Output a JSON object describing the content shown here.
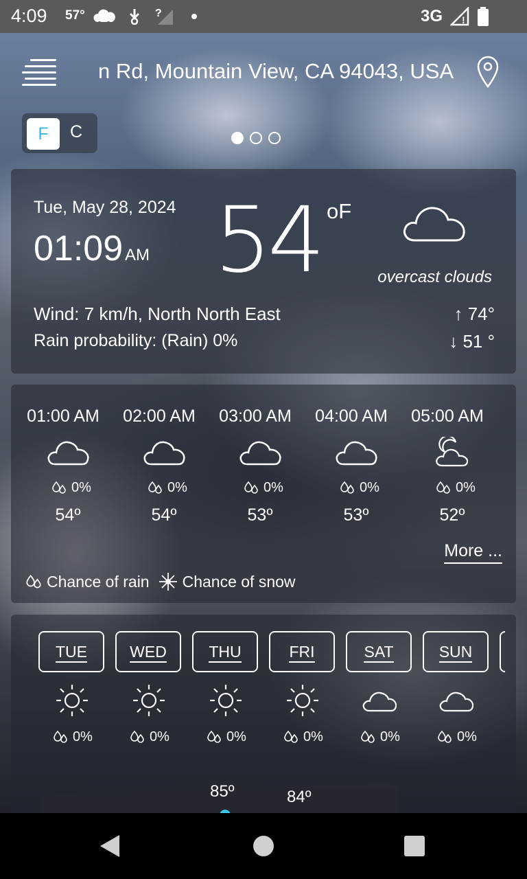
{
  "status_bar": {
    "time": "4:09",
    "temperature": "57°",
    "network": "3G",
    "icons": [
      "cloud-icon",
      "download-icon",
      "signal-unknown-icon",
      "notification-dot",
      "signal-icon",
      "battery-icon"
    ]
  },
  "header": {
    "location": "n Rd, Mountain View, CA 94043, USA",
    "menu_icon": "hamburger-menu-icon",
    "location_icon": "map-pin-icon"
  },
  "units": {
    "f": "F",
    "c": "C",
    "selected": "F"
  },
  "pager": {
    "pages": 3,
    "active": 1
  },
  "current": {
    "date": "Tue, May 28, 2024",
    "time": "01:09",
    "ampm": "AM",
    "temperature": "54",
    "unit": "oF",
    "condition": "overcast clouds",
    "wind": "Wind: 7 km/h, North North East",
    "rain_probability": "Rain probability: (Rain) 0%",
    "high": "↑  74°",
    "low": "↓  51 °"
  },
  "hourly": {
    "items": [
      {
        "time": "01:00 AM",
        "icon": "cloud-icon",
        "rain": "0%",
        "temp": "54º"
      },
      {
        "time": "02:00 AM",
        "icon": "cloud-icon",
        "rain": "0%",
        "temp": "54º"
      },
      {
        "time": "03:00 AM",
        "icon": "cloud-icon",
        "rain": "0%",
        "temp": "53º"
      },
      {
        "time": "04:00 AM",
        "icon": "cloud-icon",
        "rain": "0%",
        "temp": "53º"
      },
      {
        "time": "05:00 AM",
        "icon": "moon-cloud-icon",
        "rain": "0%",
        "temp": "52º"
      }
    ],
    "more_label": "More ...",
    "legend_rain": "Chance of rain",
    "legend_snow": "Chance of snow"
  },
  "daily": {
    "items": [
      {
        "day": "TUE",
        "icon": "sun-icon",
        "rain": "0%"
      },
      {
        "day": "WED",
        "icon": "sun-icon",
        "rain": "0%"
      },
      {
        "day": "THU",
        "icon": "sun-icon",
        "rain": "0%"
      },
      {
        "day": "FRI",
        "icon": "sun-icon",
        "rain": "0%"
      },
      {
        "day": "SAT",
        "icon": "cloud-icon",
        "rain": "0%"
      },
      {
        "day": "SUN",
        "icon": "cloud-icon",
        "rain": "0%"
      }
    ],
    "chart_highs": [
      "85º",
      "84º"
    ]
  },
  "colors": {
    "accent": "#3ec3e8",
    "card": "rgba(35,38,48,0.55)"
  }
}
